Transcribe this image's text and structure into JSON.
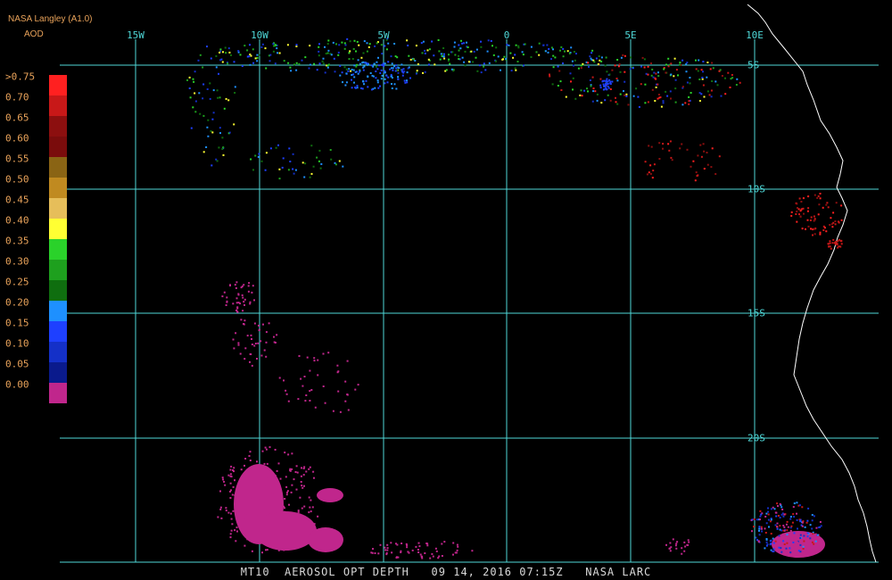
{
  "header": {
    "title": "NASA Langley (A1.0)",
    "variable": "AOD"
  },
  "legend": {
    "labels": [
      ">0.75",
      "0.70",
      "0.65",
      "0.60",
      "0.55",
      "0.50",
      "0.45",
      "0.40",
      "0.35",
      "0.30",
      "0.25",
      "0.20",
      "0.15",
      "0.10",
      "0.05",
      "0.00"
    ],
    "colors": [
      "#ff2020",
      "#c81818",
      "#8c0f0f",
      "#7a0c0c",
      "#8a6414",
      "#c08a20",
      "#e6be5a",
      "#ffff33",
      "#2ad22a",
      "#1ea01e",
      "#0f6e0f",
      "#1e90ff",
      "#1e40ff",
      "#1430c8",
      "#0a1a8c",
      "#c0268c"
    ]
  },
  "grid": {
    "longitudes": [
      "15W",
      "10W",
      "5W",
      "0",
      "5E",
      "10E"
    ],
    "latitudes": [
      "5S",
      "10S",
      "15S",
      "20S"
    ]
  },
  "footer": {
    "text": "MT10  AEROSOL OPT DEPTH   09 14, 2016 07:15Z   NASA LARC"
  },
  "colors": {
    "grid": "#4fd8d8",
    "coast": "#ffffff",
    "label": "#e8a25a"
  }
}
